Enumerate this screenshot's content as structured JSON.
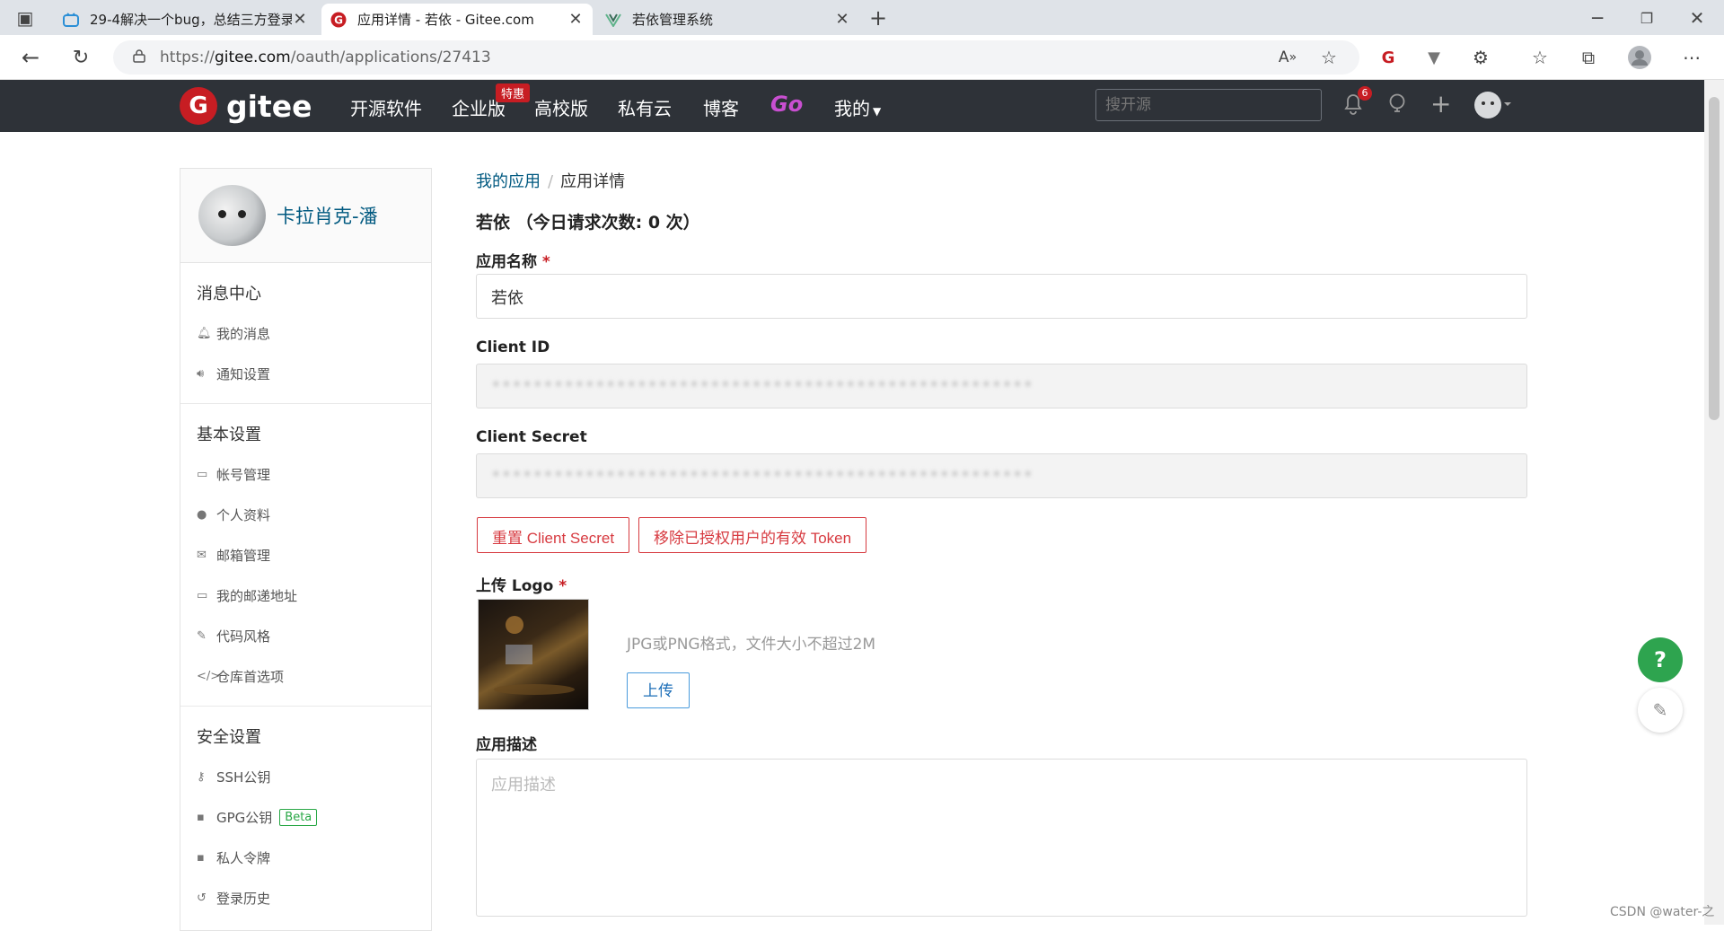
{
  "browser": {
    "tabs": [
      {
        "title": "29-4解决一个bug，总结三方登录",
        "active": false
      },
      {
        "title": "应用详情 - 若依 - Gitee.com",
        "active": true
      },
      {
        "title": "若依管理系统",
        "active": false
      }
    ],
    "new_tab": "+",
    "url": {
      "scheme": "https://",
      "host": "gitee.com",
      "path": "/oauth/applications/27413"
    }
  },
  "header": {
    "logo_letter": "G",
    "logo_text": "gitee",
    "nav": [
      "开源软件",
      "企业版",
      "高校版",
      "私有云",
      "博客",
      "Go",
      "我的"
    ],
    "enterprise_badge": "特惠",
    "search_placeholder": "搜开源",
    "notification_count": "6"
  },
  "sidebar": {
    "username": "卡拉肖克-潘",
    "sections": [
      {
        "title": "消息中心",
        "items": [
          {
            "label": "我的消息",
            "icon": "bell-icon"
          },
          {
            "label": "通知设置",
            "icon": "volume-icon"
          }
        ]
      },
      {
        "title": "基本设置",
        "items": [
          {
            "label": "帐号管理",
            "icon": "id-card-icon"
          },
          {
            "label": "个人资料",
            "icon": "user-icon"
          },
          {
            "label": "邮箱管理",
            "icon": "mail-icon"
          },
          {
            "label": "我的邮递地址",
            "icon": "address-card-icon"
          },
          {
            "label": "代码风格",
            "icon": "brush-icon"
          },
          {
            "label": "仓库首选项",
            "icon": "code-icon"
          }
        ]
      },
      {
        "title": "安全设置",
        "items": [
          {
            "label": "SSH公钥",
            "icon": "key-icon"
          },
          {
            "label": "GPG公钥",
            "icon": "lock-icon",
            "badge": "Beta"
          },
          {
            "label": "私人令牌",
            "icon": "token-icon"
          },
          {
            "label": "登录历史",
            "icon": "history-icon"
          }
        ]
      }
    ]
  },
  "main": {
    "breadcrumb": {
      "parent": "我的应用",
      "separator": "/",
      "current": "应用详情"
    },
    "title": "若依 （今日请求次数: 0 次）",
    "app_name": {
      "label": "应用名称",
      "required": "*",
      "value": "若依"
    },
    "client_id": {
      "label": "Client ID",
      "value": "••••••••••••••••••••••••••••••••••••••••••••••••••••"
    },
    "client_secret": {
      "label": "Client Secret",
      "value": "••••••••••••••••••••••••••••••••••••••••••••••••••••"
    },
    "buttons": {
      "reset_secret": "重置 Client Secret",
      "revoke_tokens": "移除已授权用户的有效 Token"
    },
    "logo": {
      "label": "上传 Logo",
      "required": "*",
      "hint": "JPG或PNG格式，文件大小不超过2M",
      "upload": "上传"
    },
    "description": {
      "label": "应用描述",
      "placeholder": "应用描述"
    }
  },
  "floating": {
    "help": "?"
  },
  "watermark": "CSDN @water-之"
}
